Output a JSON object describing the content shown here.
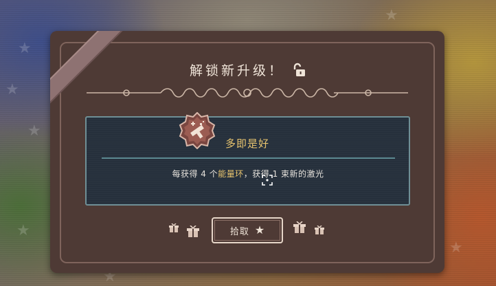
{
  "dialog": {
    "title": "解锁新升级！",
    "lock_icon": "unlocked-padlock-icon"
  },
  "upgrade": {
    "name": "多即是好",
    "icon": "laser-gun-badge-icon",
    "description_parts": [
      "每获得 4 个",
      "能量环",
      "，获得 1 束新的激光"
    ]
  },
  "actions": {
    "pickup_label": "拾取",
    "pickup_icon": "star-icon"
  },
  "colors": {
    "panel": "#4e3a35",
    "info_box": "#26303c",
    "highlight": "#e8c46e",
    "text": "#efe4d8"
  }
}
